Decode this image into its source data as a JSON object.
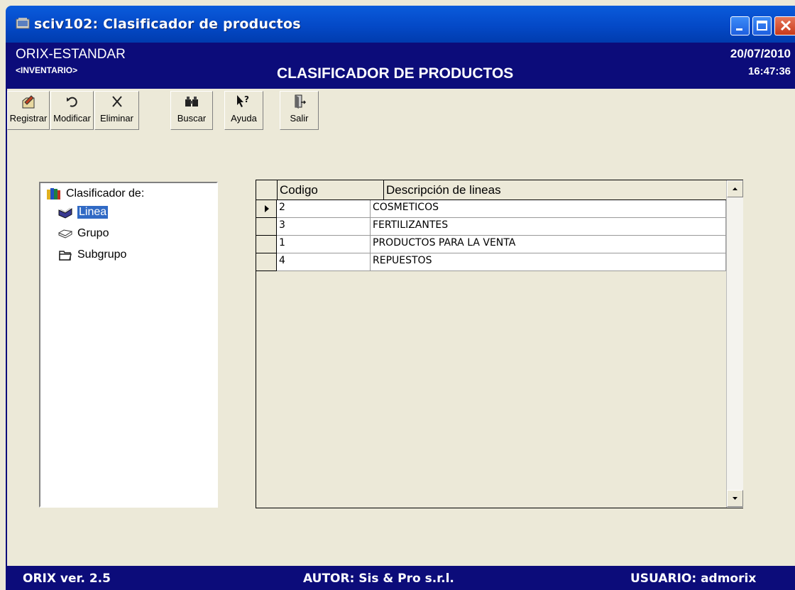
{
  "window": {
    "title": "sciv102: Clasificador de productos"
  },
  "header": {
    "app_name": "ORIX-ESTANDAR",
    "module": "<INVENTARIO>",
    "title": "CLASIFICADOR DE PRODUCTOS",
    "date": "20/07/2010",
    "time": "16:47:36"
  },
  "toolbar": {
    "registrar": "Registrar",
    "modificar": "Modificar",
    "eliminar": "Eliminar",
    "buscar": "Buscar",
    "ayuda": "Ayuda",
    "salir": "Salir"
  },
  "tree": {
    "root": "Clasificador de:",
    "items": [
      "Linea",
      "Grupo",
      "Subgrupo"
    ],
    "selected": "Linea"
  },
  "grid": {
    "columns": [
      "Codigo",
      "Descripción de lineas"
    ],
    "rows": [
      {
        "codigo": "2",
        "descripcion": "COSMETICOS"
      },
      {
        "codigo": "3",
        "descripcion": "FERTILIZANTES"
      },
      {
        "codigo": "1",
        "descripcion": "PRODUCTOS PARA LA VENTA"
      },
      {
        "codigo": "4",
        "descripcion": "REPUESTOS"
      }
    ]
  },
  "status": {
    "version": "ORIX ver. 2.5",
    "author": "AUTOR: Sis & Pro s.r.l.",
    "user": "USUARIO: admorix"
  },
  "colors": {
    "header_bg": "#0C0C7A",
    "titlebar": "#0449C7",
    "selection": "#316AC5",
    "window_bg": "#ECE9D8"
  },
  "icons": {
    "title": "app-icon",
    "registrar": "register-icon",
    "modificar": "undo-icon",
    "eliminar": "delete-icon",
    "buscar": "binoculars-icon",
    "ayuda": "help-icon",
    "salir": "exit-door-icon"
  }
}
